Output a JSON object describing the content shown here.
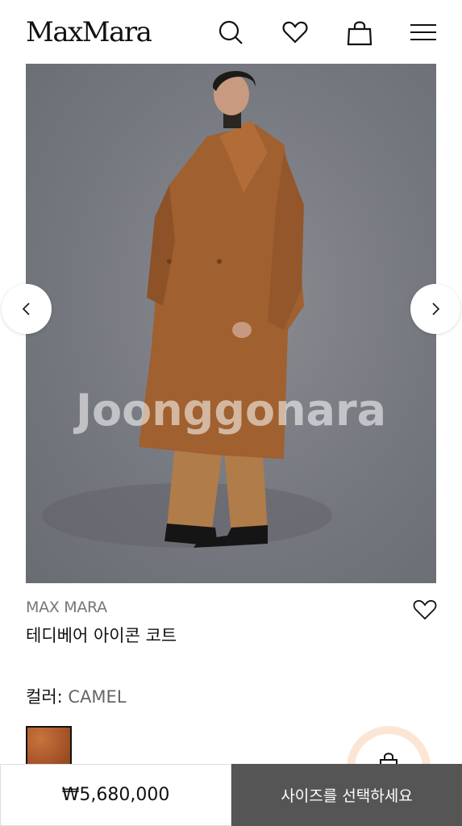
{
  "header": {
    "logo": "MaxMara",
    "icons": [
      "search-icon",
      "heart-icon",
      "shopping-bag-icon",
      "menu-icon"
    ]
  },
  "gallery": {
    "watermark": "Joonggonara",
    "prev_icon": "chevron-left-icon",
    "next_icon": "chevron-right-icon"
  },
  "product": {
    "brand": "MAX MARA",
    "name": "테디베어 아이콘 코트",
    "color_label": "컬러:",
    "color_value": "CAMEL",
    "swatch_color": "#a9572a"
  },
  "footer": {
    "price": "₩5,680,000",
    "cta": "사이즈를 선택하세요"
  },
  "colors": {
    "cta_bg": "#555555",
    "float_ring": "#fbe6d6"
  }
}
